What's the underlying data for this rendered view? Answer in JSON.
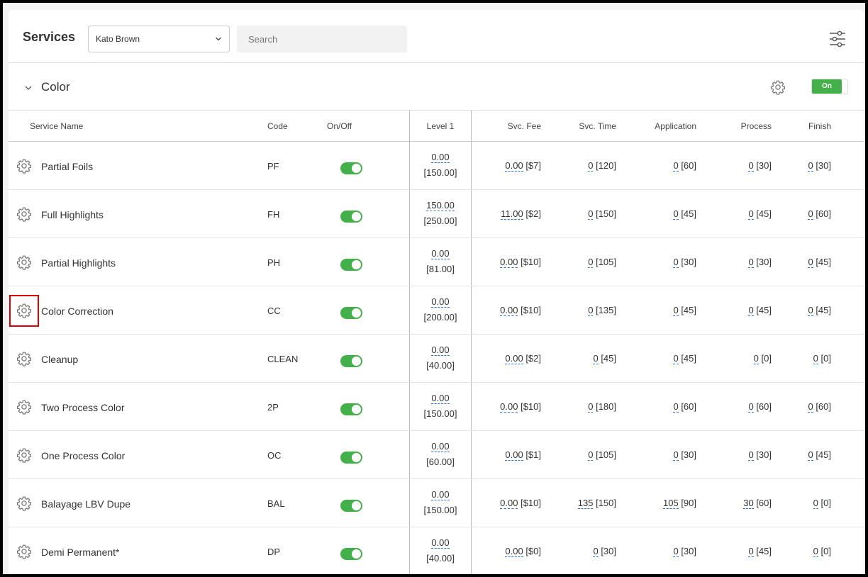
{
  "header": {
    "title": "Services",
    "staff_selected": "Kato Brown",
    "search_placeholder": "Search"
  },
  "section": {
    "title": "Color",
    "toggle_label": "On"
  },
  "columns": {
    "service_name": "Service Name",
    "code": "Code",
    "on_off": "On/Off",
    "level1": "Level 1",
    "svc_fee": "Svc. Fee",
    "svc_time": "Svc. Time",
    "application": "Application",
    "process": "Process",
    "finish": "Finish"
  },
  "rows": [
    {
      "name": "Partial Foils",
      "code": "PF",
      "price": "0.00",
      "base": "[150.00]",
      "fee": "0.00",
      "fee_b": "[$7]",
      "time": "0",
      "time_b": "[120]",
      "app": "0",
      "app_b": "[60]",
      "proc": "0",
      "proc_b": "[30]",
      "fin": "0",
      "fin_b": "[30]"
    },
    {
      "name": "Full Highlights",
      "code": "FH",
      "price": "150.00",
      "base": "[250.00]",
      "fee": "11.00",
      "fee_b": "[$2]",
      "time": "0",
      "time_b": "[150]",
      "app": "0",
      "app_b": "[45]",
      "proc": "0",
      "proc_b": "[45]",
      "fin": "0",
      "fin_b": "[60]"
    },
    {
      "name": "Partial Highlights",
      "code": "PH",
      "price": "0.00",
      "base": "[81.00]",
      "fee": "0.00",
      "fee_b": "[$10]",
      "time": "0",
      "time_b": "[105]",
      "app": "0",
      "app_b": "[30]",
      "proc": "0",
      "proc_b": "[30]",
      "fin": "0",
      "fin_b": "[45]"
    },
    {
      "name": "Color Correction",
      "code": "CC",
      "price": "0.00",
      "base": "[200.00]",
      "fee": "0.00",
      "fee_b": "[$10]",
      "time": "0",
      "time_b": "[135]",
      "app": "0",
      "app_b": "[45]",
      "proc": "0",
      "proc_b": "[45]",
      "fin": "0",
      "fin_b": "[45]"
    },
    {
      "name": "Cleanup",
      "code": "CLEAN",
      "price": "0.00",
      "base": "[40.00]",
      "fee": "0.00",
      "fee_b": "[$2]",
      "time": "0",
      "time_b": "[45]",
      "app": "0",
      "app_b": "[45]",
      "proc": "0",
      "proc_b": "[0]",
      "fin": "0",
      "fin_b": "[0]"
    },
    {
      "name": "Two Process Color",
      "code": "2P",
      "price": "0.00",
      "base": "[150.00]",
      "fee": "0.00",
      "fee_b": "[$10]",
      "time": "0",
      "time_b": "[180]",
      "app": "0",
      "app_b": "[60]",
      "proc": "0",
      "proc_b": "[60]",
      "fin": "0",
      "fin_b": "[60]"
    },
    {
      "name": "One Process Color",
      "code": "OC",
      "price": "0.00",
      "base": "[60.00]",
      "fee": "0.00",
      "fee_b": "[$1]",
      "time": "0",
      "time_b": "[105]",
      "app": "0",
      "app_b": "[30]",
      "proc": "0",
      "proc_b": "[30]",
      "fin": "0",
      "fin_b": "[45]"
    },
    {
      "name": "Balayage LBV Dupe",
      "code": "BAL",
      "price": "0.00",
      "base": "[150.00]",
      "fee": "0.00",
      "fee_b": "[$10]",
      "time": "135",
      "time_b": "[150]",
      "app": "105",
      "app_b": "[90]",
      "proc": "30",
      "proc_b": "[60]",
      "fin": "0",
      "fin_b": "[0]"
    },
    {
      "name": "Demi Permanent*",
      "code": "DP",
      "price": "0.00",
      "base": "[40.00]",
      "fee": "0.00",
      "fee_b": "[$0]",
      "time": "0",
      "time_b": "[30]",
      "app": "0",
      "app_b": "[30]",
      "proc": "0",
      "proc_b": "[45]",
      "fin": "0",
      "fin_b": "[0]"
    }
  ]
}
